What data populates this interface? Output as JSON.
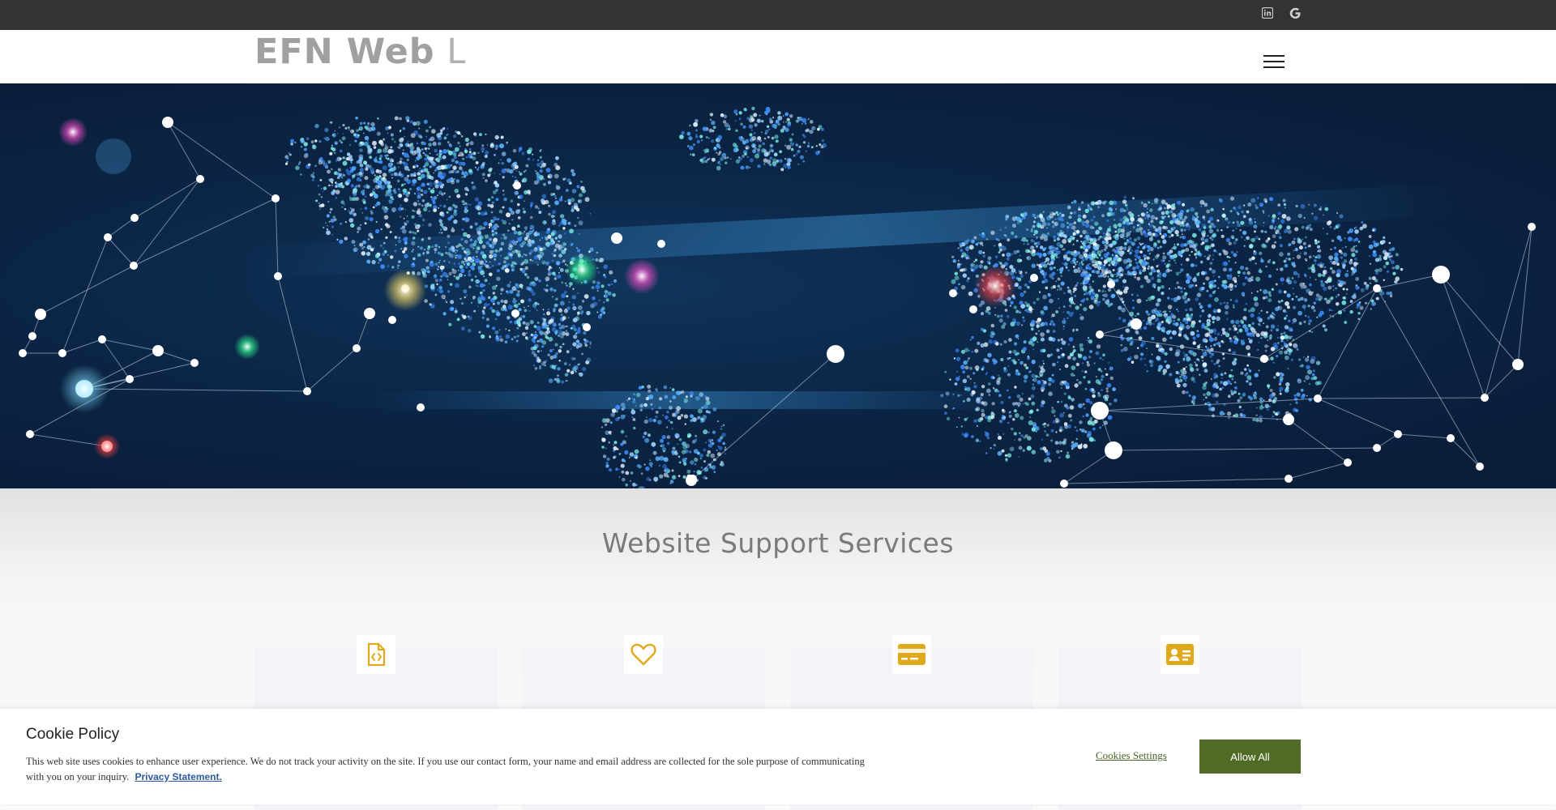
{
  "topbar": {
    "social_icons": [
      "linkedin-icon",
      "google-icon"
    ],
    "social_glyphs": [
      "in",
      "G"
    ]
  },
  "header": {
    "logo_bold": "EFN Web",
    "logo_light": "LLC",
    "menu_icon": "hamburger-menu-icon"
  },
  "section": {
    "title": "Website Support Services",
    "cards": [
      {
        "icon": "code-file-icon"
      },
      {
        "icon": "heart-icon"
      },
      {
        "icon": "credit-card-icon"
      },
      {
        "icon": "contact-card-icon"
      }
    ]
  },
  "cookie": {
    "title": "Cookie Policy",
    "text": "This web site uses cookies to enhance user experience. We do not track your activity on the site. If you use our contact form, your name and email address are collected for the sole purpose of communicating with you on your inquiry.",
    "privacy_link": "Privacy Statement.",
    "settings_label": "Cookies Settings",
    "allow_label": "Allow All"
  },
  "colors": {
    "topbar": "#333333",
    "accent_gold": "#e0a81c",
    "allow_button": "#4f6b25",
    "hero_bg": "#0b2546"
  }
}
